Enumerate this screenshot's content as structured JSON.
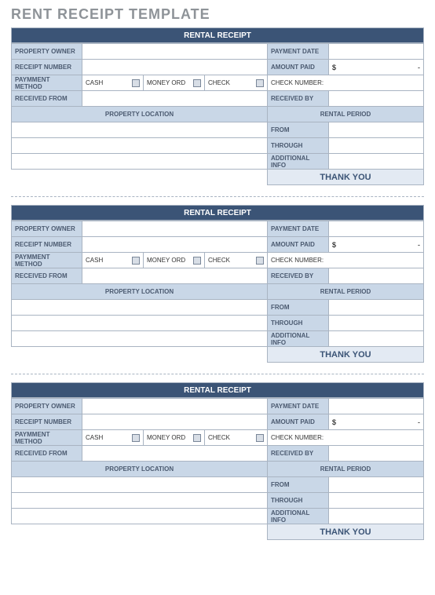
{
  "page": {
    "title": "RENT RECEIPT TEMPLATE"
  },
  "receipt": {
    "header": "RENTAL RECEIPT",
    "labels": {
      "property_owner": "PROPERTY OWNER",
      "receipt_number": "RECEIPT NUMBER",
      "payment_method": "PAYMMENT METHOD",
      "received_from": "RECEIVED FROM",
      "payment_date": "PAYMENT DATE",
      "amount_paid": "AMOUNT PAID",
      "received_by": "RECEIVED BY",
      "property_location": "PROPERTY LOCATION",
      "rental_period": "RENTAL PERIOD",
      "from": "FROM",
      "through": "THROUGH",
      "additional_info": "ADDITIONAL INFO",
      "thank_you": "THANK YOU"
    },
    "payment_methods": {
      "cash": "CASH",
      "money_ord": "MONEY ORD",
      "check": "CHECK",
      "check_number": "CHECK NUMBER:"
    },
    "values": {
      "property_owner": "",
      "receipt_number": "",
      "payment_date": "",
      "amount_symbol": "$",
      "amount_value": "-",
      "received_from": "",
      "received_by": "",
      "property_location_lines": [
        "",
        "",
        ""
      ],
      "from": "",
      "through": "",
      "additional_info": "",
      "check_number": ""
    }
  }
}
